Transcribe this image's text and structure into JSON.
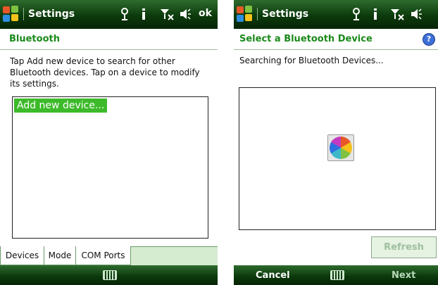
{
  "left": {
    "title": "Settings",
    "status_ok": "ok",
    "subheader": "Bluetooth",
    "help_text": "Tap Add new device to search for other Bluetooth devices. Tap on a device to modify its settings.",
    "list_items": [
      "Add new device..."
    ],
    "tabs": [
      "Devices",
      "Mode",
      "COM Ports"
    ]
  },
  "right": {
    "title": "Settings",
    "subheader": "Select a Bluetooth Device",
    "help_glyph": "?",
    "status_text": "Searching for Bluetooth Devices...",
    "refresh_label": "Refresh",
    "soft_left": "Cancel",
    "soft_right": "Next"
  },
  "icons": {
    "start": "windows-flag-icon",
    "antenna": "antenna-icon",
    "info": "info-icon",
    "signal": "no-signal-icon",
    "volume": "volume-icon",
    "keyboard": "keyboard-icon",
    "busy": "busy-wheel-icon"
  }
}
